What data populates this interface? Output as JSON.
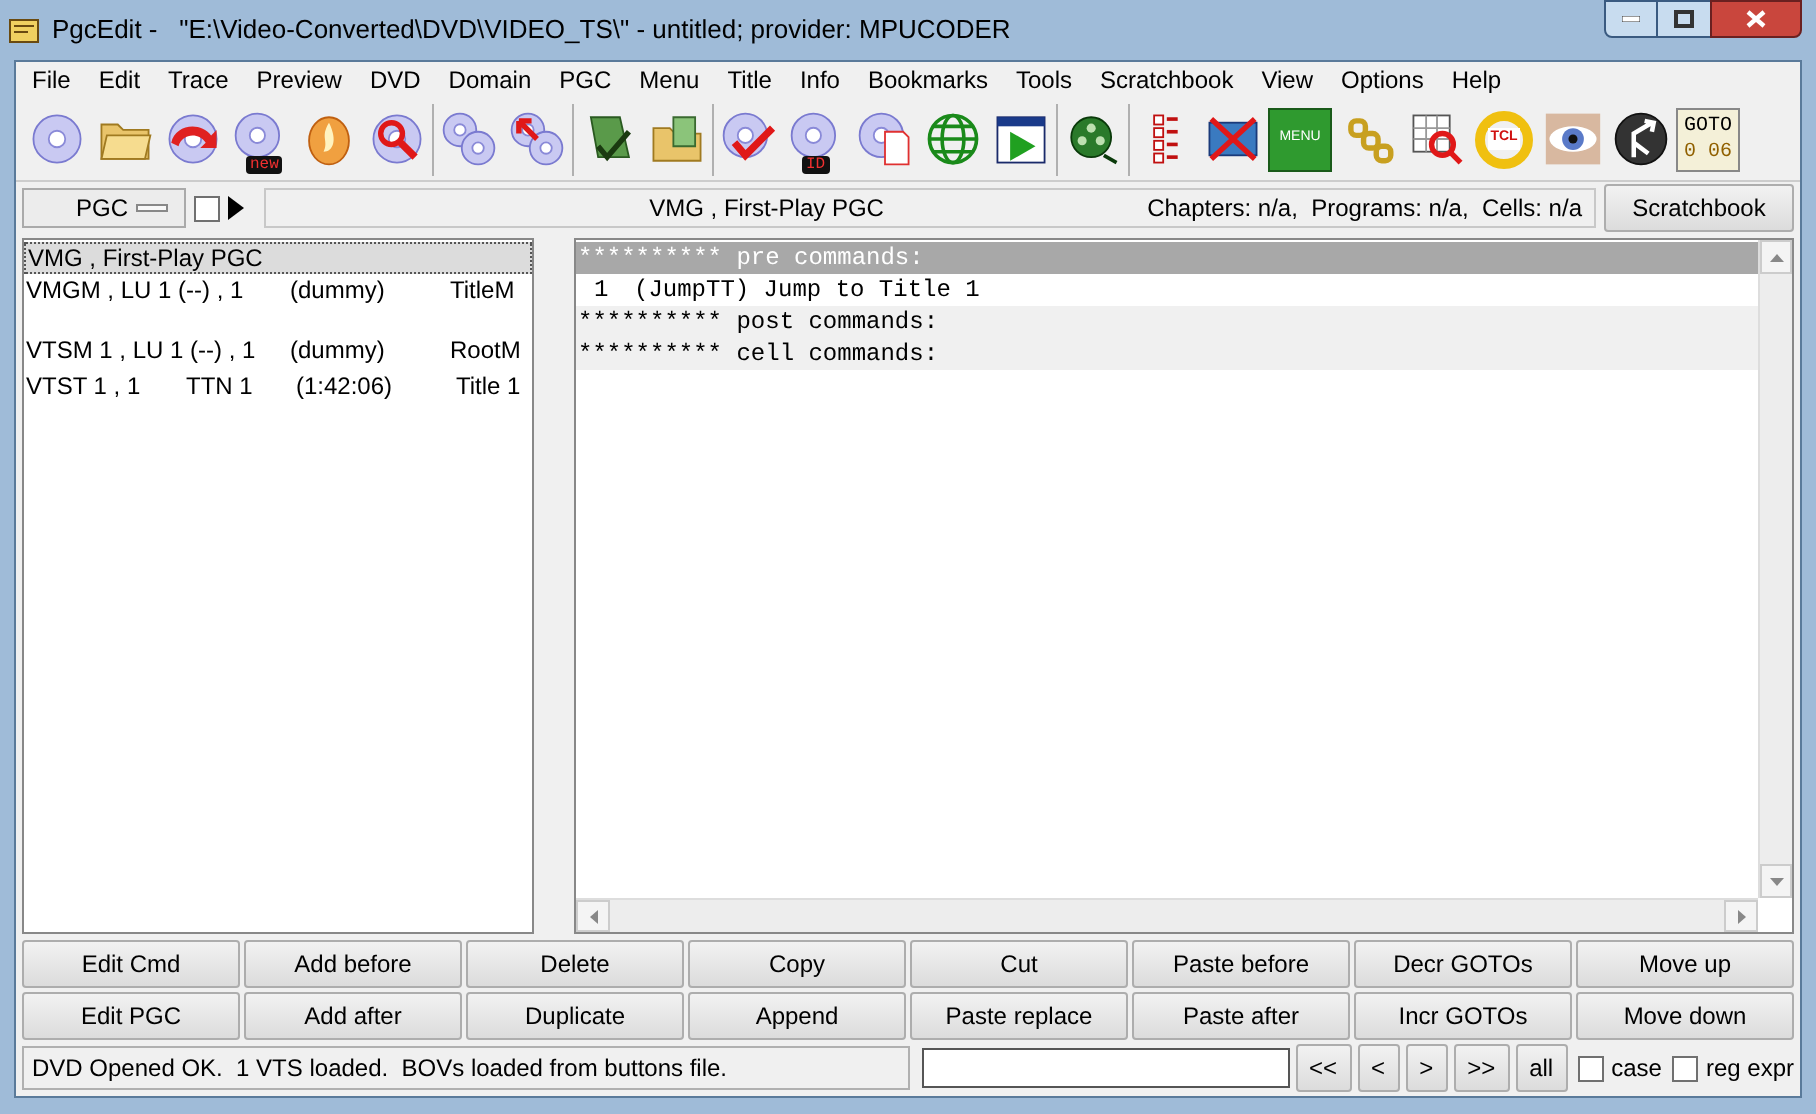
{
  "window": {
    "title": "PgcEdit -   \"E:\\Video-Converted\\DVD\\VIDEO_TS\\\" - untitled; provider: MPUCODER"
  },
  "menu": [
    "File",
    "Edit",
    "Trace",
    "Preview",
    "DVD",
    "Domain",
    "PGC",
    "Menu",
    "Title",
    "Info",
    "Bookmarks",
    "Tools",
    "Scratchbook",
    "View",
    "Options",
    "Help"
  ],
  "toolbar": [
    [
      {
        "kind": "disc"
      },
      {
        "kind": "folder"
      },
      {
        "kind": "disc-arrow"
      },
      {
        "kind": "disc-badge",
        "label": "new"
      },
      {
        "kind": "flame"
      },
      {
        "kind": "search"
      }
    ],
    [
      {
        "kind": "discs"
      },
      {
        "kind": "discs-arrow"
      }
    ],
    [
      {
        "kind": "green-doc"
      },
      {
        "kind": "folder-check"
      }
    ],
    [
      {
        "kind": "disc-check"
      },
      {
        "kind": "disc-badge",
        "label": "ID"
      },
      {
        "kind": "disc-doc"
      },
      {
        "kind": "globe"
      },
      {
        "kind": "play-grid"
      }
    ],
    [
      {
        "kind": "reel"
      }
    ],
    [
      {
        "kind": "checklist"
      },
      {
        "kind": "film-cross"
      },
      {
        "kind": "menu",
        "label": "MENU"
      },
      {
        "kind": "chain"
      },
      {
        "kind": "grid-search"
      },
      {
        "kind": "tcl",
        "label": "TCL"
      },
      {
        "kind": "eye"
      },
      {
        "kind": "jump"
      },
      {
        "kind": "goto",
        "label": "GOTO",
        "value": "0 06"
      }
    ]
  ],
  "selector": {
    "value": "PGC",
    "checked": false
  },
  "info": {
    "current": "VMG , First-Play PGC",
    "counts": "Chapters: n/a,  Programs: n/a,  Cells: n/a",
    "button": "Scratchbook"
  },
  "pgc_list": [
    {
      "cols": [
        "VMG , First-Play PGC"
      ],
      "selected": true,
      "spaced": false
    },
    {
      "cols": [
        "VMGM , LU 1 (--) , 1",
        "(dummy)",
        "TitleM"
      ],
      "selected": false,
      "spaced": false
    },
    {
      "cols": [
        "VTSM 1 , LU 1 (--) , 1",
        "(dummy)",
        "RootM"
      ],
      "selected": false,
      "spaced": true
    },
    {
      "cols": [
        "VTST 1 , 1",
        "TTN 1",
        "(1:42:06)",
        "Title 1"
      ],
      "selected": false,
      "spaced": false
    }
  ],
  "commands": [
    {
      "kind": "header",
      "text": "********** pre commands:",
      "selected": true
    },
    {
      "kind": "command",
      "number": "1",
      "text": "(JumpTT) Jump to Title 1",
      "selected": false
    },
    {
      "kind": "header",
      "text": "********** post commands:",
      "selected": false
    },
    {
      "kind": "header",
      "text": "********** cell commands:",
      "selected": false
    }
  ],
  "buttons": [
    [
      "Edit Cmd",
      "Add before",
      "Delete",
      "Copy",
      "Cut",
      "Paste before",
      "Decr GOTOs",
      "Move up"
    ],
    [
      "Edit PGC",
      "Add after",
      "Duplicate",
      "Append",
      "Paste replace",
      "Paste after",
      "Incr GOTOs",
      "Move down"
    ]
  ],
  "status": {
    "text": "DVD Opened OK.  1 VTS loaded.  BOVs loaded from buttons file.",
    "nav": [
      "<<",
      "<",
      ">",
      ">>",
      "all"
    ],
    "options": [
      {
        "label": "case",
        "checked": false
      },
      {
        "label": "reg expr",
        "checked": false
      }
    ]
  }
}
